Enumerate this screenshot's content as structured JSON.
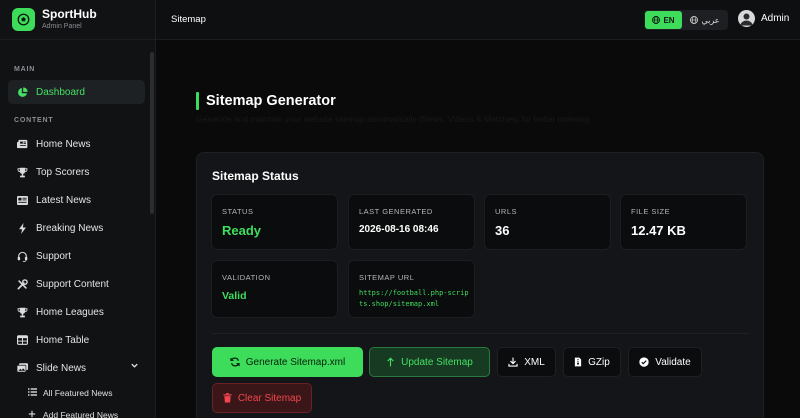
{
  "brand": {
    "name": "SportHub",
    "subtitle": "Admin Panel"
  },
  "sidebar": {
    "sections": {
      "main": "MAIN",
      "content": "CONTENT"
    },
    "items": [
      {
        "label": "Dashboard",
        "icon": "pie-chart-icon",
        "active": true
      },
      {
        "label": "Home News",
        "icon": "newspaper-icon"
      },
      {
        "label": "Top Scorers",
        "icon": "trophy-icon"
      },
      {
        "label": "Latest News",
        "icon": "news-icon"
      },
      {
        "label": "Breaking News",
        "icon": "bolt-icon"
      },
      {
        "label": "Support",
        "icon": "headset-icon"
      },
      {
        "label": "Support Content",
        "icon": "tools-icon"
      },
      {
        "label": "Home Leagues",
        "icon": "trophy-icon"
      },
      {
        "label": "Home Table",
        "icon": "table-icon"
      },
      {
        "label": "Slide News",
        "icon": "slides-icon",
        "expanded": true
      }
    ],
    "subitems": [
      {
        "label": "All Featured News",
        "icon": "list-icon"
      },
      {
        "label": "Add Featured News",
        "icon": "plus-icon"
      }
    ]
  },
  "topbar": {
    "breadcrumb": "Sitemap",
    "lang_en": "EN",
    "lang_ar": "عربي",
    "user_name": "Admin"
  },
  "page": {
    "title": "Sitemap Generator",
    "subtitle": "Generate and maintain your website sitemap automatically (News, Videos & Matches) for better indexing."
  },
  "status_card": {
    "title": "Sitemap Status",
    "stats": {
      "status": {
        "label": "STATUS",
        "value": "Ready"
      },
      "last_generated": {
        "label": "LAST GENERATED",
        "value": "2026-08-16 08:46"
      },
      "urls": {
        "label": "URLS",
        "value": "36"
      },
      "file_size": {
        "label": "FILE SIZE",
        "value": "12.47 KB"
      },
      "validation": {
        "label": "VALIDATION",
        "value": "Valid"
      },
      "sitemap_url": {
        "label": "SITEMAP URL",
        "value": "https://football.php-scripts.shop/sitemap.xml"
      }
    }
  },
  "actions": {
    "generate": "Generate Sitemap.xml",
    "update": "Update Sitemap",
    "xml": "XML",
    "gzip": "GZip",
    "validate": "Validate",
    "clear": "Clear Sitemap"
  },
  "colors": {
    "accent": "#3ddc5a",
    "danger": "#f0474e",
    "background": "#0a0a0b",
    "card": "#141518"
  }
}
